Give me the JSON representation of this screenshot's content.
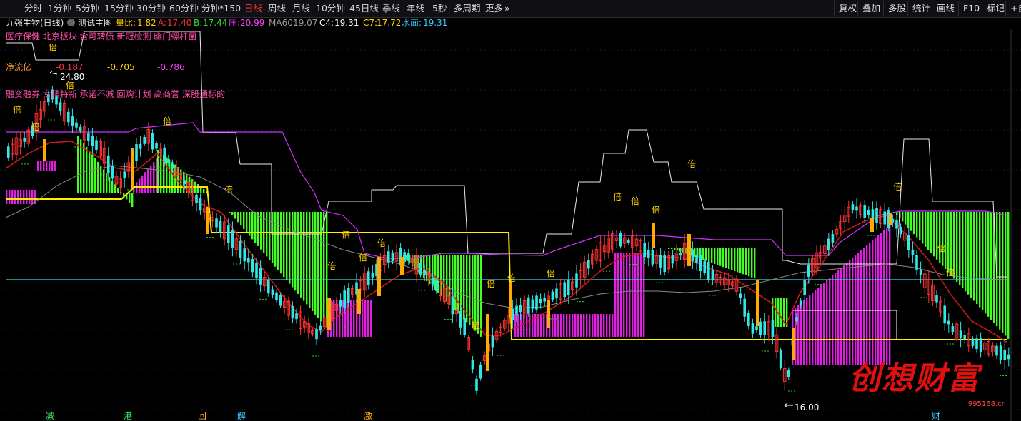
{
  "periods": [
    "分时",
    "1分钟",
    "5分钟",
    "15分钟",
    "30分钟",
    "60分钟",
    "分钟*150",
    "日线",
    "周线",
    "月线",
    "10分钟",
    "45日线",
    "季线",
    "年线",
    "5秒",
    "多周期",
    "更多"
  ],
  "active_period": "日线",
  "right_tools": [
    "复权",
    "叠加",
    "多股",
    "统计",
    "画线",
    "F10",
    "标记",
    "+自"
  ],
  "stock": {
    "name": "九强生物(日线)",
    "indicator": "测试主图"
  },
  "metrics": [
    {
      "label": "量比:",
      "value": "1.82",
      "color": "#ffd400"
    },
    {
      "label": "A:",
      "value": "17.40",
      "color": "#ff3333"
    },
    {
      "label": "B:",
      "value": "17.44",
      "color": "#33dd33"
    },
    {
      "label": "压:",
      "value": "20.99",
      "color": "#ff40ff"
    },
    {
      "label": "MA60:",
      "value": "19.07",
      "color": "#9a9a9a"
    },
    {
      "label": "C4:",
      "value": "19.31",
      "color": "#ffffff"
    },
    {
      "label": "C7:",
      "value": "17.72",
      "color": "#ffd400"
    },
    {
      "label": "水面:",
      "value": "19.31",
      "color": "#33ccff"
    }
  ],
  "concepts_line1": "医疗保健 北京板块 含可转债 新冠检测 幽门螺杆菌",
  "concepts_line2": "融资融券 专精特新 承诺不减 回购计划 高商誉 深股通标的",
  "net_flow": {
    "label": "净流亿",
    "values": [
      "-0.187",
      "-0.705",
      "-0.786"
    ],
    "colors": [
      "#ff3333",
      "#ffd400",
      "#ff40ff"
    ]
  },
  "price_high_label": "24.80",
  "price_low_label": "16.00",
  "bei_marker": "倍",
  "bottom_events": [
    {
      "text": "减",
      "color": "#33ee66"
    },
    {
      "text": "港",
      "color": "#33ee66"
    },
    {
      "text": "回",
      "color": "#ffb000"
    },
    {
      "text": "解",
      "color": "#33ccff"
    },
    {
      "text": "激",
      "color": "#ffb000"
    },
    {
      "text": "财",
      "color": "#33ccff"
    }
  ],
  "watermark": {
    "text": "创想财富",
    "url": "995168.cn"
  },
  "colors": {
    "up": "#ff3333",
    "down": "#33e6e6",
    "green_bar": "#44ff22",
    "magenta_bar": "#e020e0",
    "yellow": "#ffee00",
    "purple_line": "#cc33ff",
    "water": "#33dddd",
    "ma60": "#888888"
  }
}
